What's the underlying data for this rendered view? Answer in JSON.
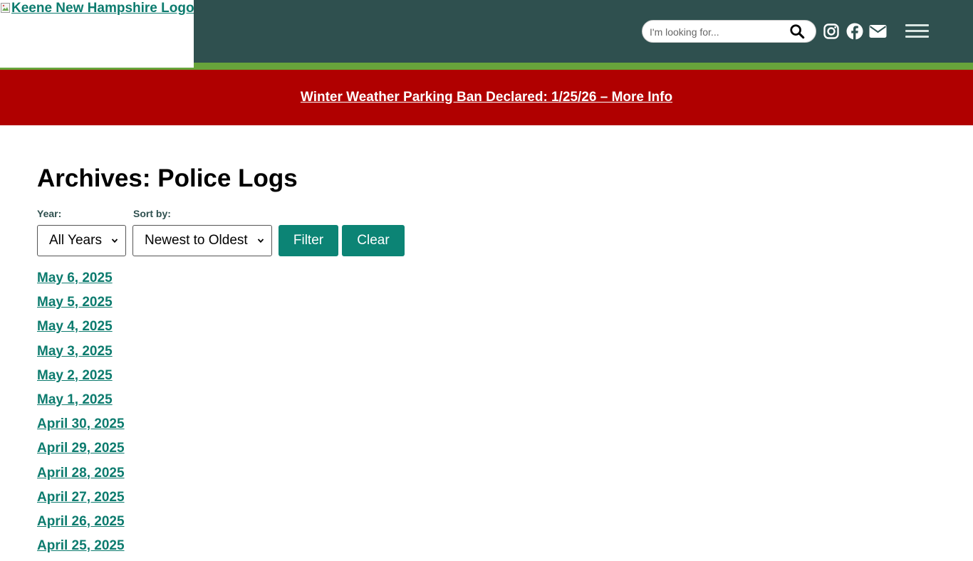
{
  "header": {
    "logo_alt": "Keene New Hampshire Logo",
    "search": {
      "placeholder": "I'm looking for..."
    },
    "icons": [
      "search-icon",
      "instagram-icon",
      "facebook-icon",
      "email-icon",
      "menu-icon"
    ],
    "colors": {
      "header_bg": "#2f504f",
      "stripe": "#68a43b",
      "alert_bg": "#b00000",
      "link": "#0c7b6e",
      "button_bg": "#0c8475"
    }
  },
  "alert": {
    "text": "Winter Weather Parking Ban Declared: 1/25/26 – More Info"
  },
  "main": {
    "title": "Archives: Police Logs",
    "filters": {
      "year_label": "Year:",
      "year_value": "All Years",
      "sort_label": "Sort by:",
      "sort_value": "Newest to Oldest",
      "filter_button": "Filter",
      "clear_button": "Clear"
    },
    "logs": [
      "May 6, 2025",
      "May 5, 2025",
      "May 4, 2025",
      "May 3, 2025",
      "May 2, 2025",
      "May 1, 2025",
      "April 30, 2025",
      "April 29, 2025",
      "April 28, 2025",
      "April 27, 2025",
      "April 26, 2025",
      "April 25, 2025"
    ]
  }
}
